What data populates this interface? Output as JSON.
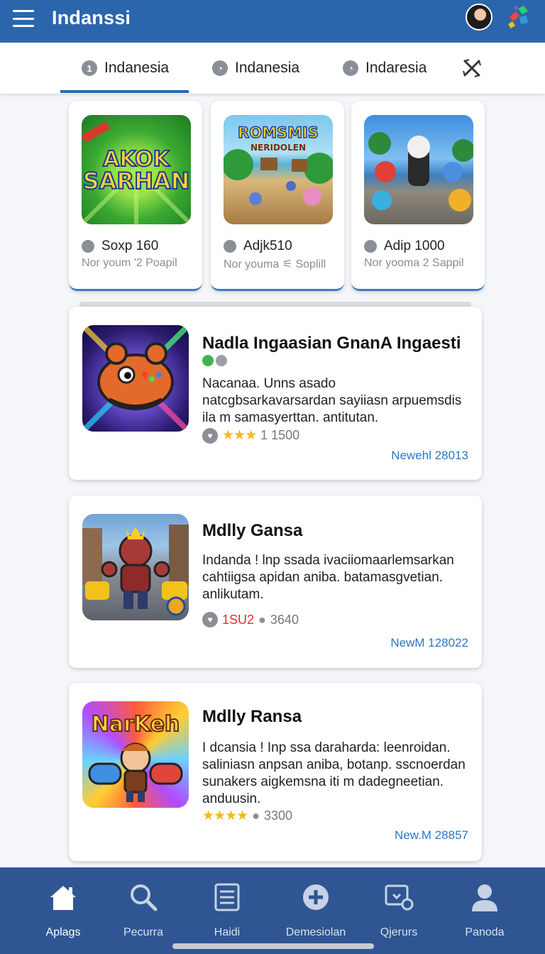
{
  "app": {
    "title": "Indanssi",
    "menu_icon": "hamburger-icon",
    "avatar_icon": "avatar",
    "extra_icon": "puzzle-icon",
    "brand_color": "#2b66ad"
  },
  "tabs": [
    {
      "label": "Indanesia",
      "icon": "number-one-icon",
      "selected": true
    },
    {
      "label": "Indanesia",
      "icon": "clock-icon",
      "selected": false
    },
    {
      "label": "Indaresia",
      "icon": "clock-icon",
      "selected": false
    }
  ],
  "tab_close_icon": "close-icon",
  "featured": [
    {
      "title": "Soxp 160",
      "subtitle": "Nor youm '2 Poapil",
      "image_text": "AKOK SARHAN",
      "image_icon": "game-art-logo"
    },
    {
      "title": "Adjk510",
      "subtitle": "Nor youma ⚟ Soplill",
      "image_text": "ROMSMIS",
      "image_subtext": "NERIDOLEN",
      "image_icon": "game-art-island"
    },
    {
      "title": "Adip 1000",
      "subtitle": "Nor yooma 2 Sappil",
      "image_icon": "game-art-characters"
    }
  ],
  "list": [
    {
      "title": "Nadla Ingaasian GnanA Ingaesti",
      "description": "Nacanaa. Unns asado natcgbsarkavarsardan sayiiasn arpuemsdis ila m samasyerttan. antitutan.",
      "rating_stars": "★★★",
      "count": "1 1500",
      "date": "Newehl 28013",
      "verified": true,
      "image_icon": "gamepad-mascot-art"
    },
    {
      "title": "Mdlly Gansa",
      "description": "Indanda ! lnp ssada ivaciiomaarlemsarkan cahtiigsa apidan aniba. batamasgvetian. anlikutam.",
      "rating": "1SU2",
      "count": "3640",
      "date": "NewM 128022",
      "image_icon": "hero-street-art"
    },
    {
      "title": "Mdlly Ransa",
      "description": "I dcansia ! Inp ssa daraharda: leenroidan. saliniasn anpsan aniba, botanp. sscnoerdan sunakers aigkemsna iti m dadegneetian. anduusin.",
      "rating_stars": "★★★★",
      "count": "3300",
      "date": "New.M 28857",
      "image_text": "NarKeh",
      "image_icon": "boy-controllers-art"
    }
  ],
  "bottom_nav": [
    {
      "label": "Aplags",
      "icon": "home-icon",
      "active": true
    },
    {
      "label": "Pecurra",
      "icon": "search-icon",
      "active": false
    },
    {
      "label": "Haidi",
      "icon": "list-icon",
      "active": false
    },
    {
      "label": "Demesiolan",
      "icon": "plus-circle-icon",
      "active": false
    },
    {
      "label": "Qjerurs",
      "icon": "download-icon",
      "active": false
    },
    {
      "label": "Panoda",
      "icon": "profile-icon",
      "active": false
    }
  ],
  "colors": {
    "star": "#f5b81c",
    "date_link": "#2a78c4",
    "nav_bg": "#2f5692"
  }
}
